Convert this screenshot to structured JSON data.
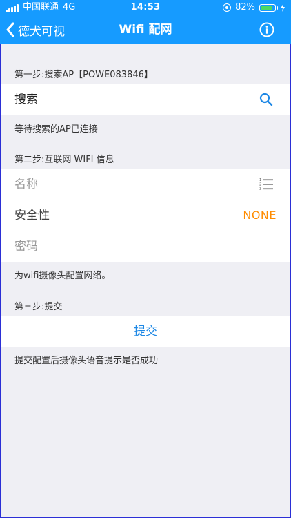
{
  "status": {
    "carrier": "中国联通",
    "network": "4G",
    "time": "14:53",
    "battery": "82%"
  },
  "nav": {
    "back_label": "德犬可视",
    "title": "Wifi 配网"
  },
  "step1": {
    "label": "第一步:搜索AP【POWE083846】",
    "search_label": "搜索",
    "hint": "等待搜索的AP已连接"
  },
  "step2": {
    "label": "第二步:互联网 WIFI 信息",
    "name_placeholder": "名称",
    "security_label": "安全性",
    "security_value": "NONE",
    "password_placeholder": "密码",
    "hint": "为wifi摄像头配置网络。"
  },
  "step3": {
    "label": "第三步:提交",
    "submit_label": "提交",
    "hint": "提交配置后摄像头语音提示是否成功"
  },
  "colors": {
    "nav_bg": "#169bff",
    "accent": "#1e88e5",
    "security_value": "#ff8c00"
  },
  "icons": [
    "back-chevron-icon",
    "info-icon",
    "search-icon",
    "list-icon",
    "orientation-lock-icon",
    "battery-icon",
    "charging-bolt-icon",
    "signal-icon"
  ]
}
